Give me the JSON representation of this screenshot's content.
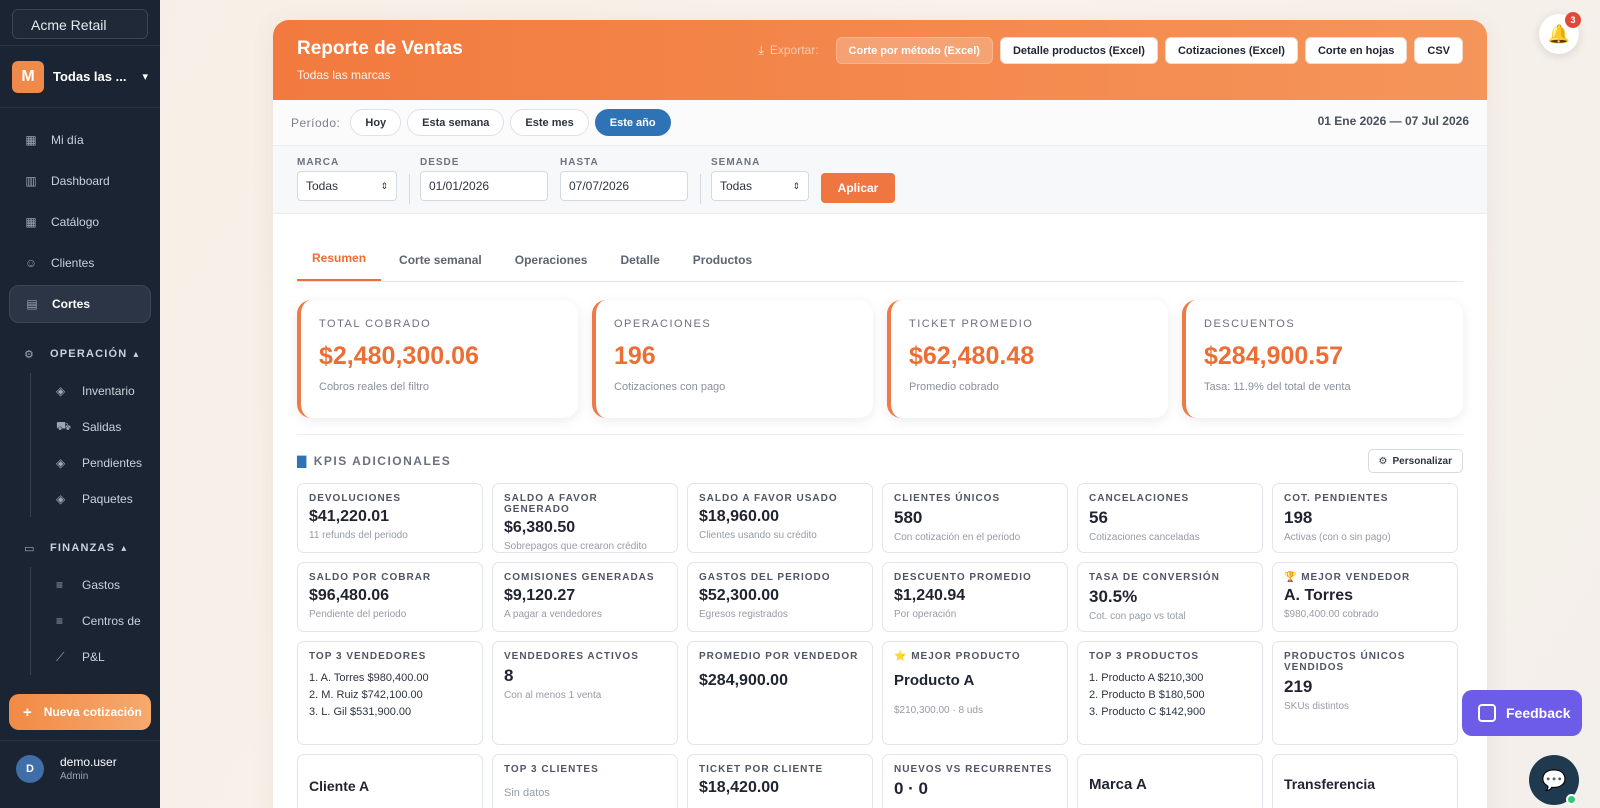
{
  "sidebar": {
    "search_value": "Acme Retail",
    "brand": {
      "initial": "M",
      "name": "Todas las ..."
    },
    "nav": [
      {
        "label": "Mi día",
        "icon": "calendar-icon",
        "active": false
      },
      {
        "label": "Dashboard",
        "icon": "chart-icon",
        "active": false
      },
      {
        "label": "Catálogo",
        "icon": "grid-icon",
        "active": false
      },
      {
        "label": "Clientes",
        "icon": "users-icon",
        "active": false
      },
      {
        "label": "Cortes",
        "icon": "document-icon",
        "active": true
      }
    ],
    "operacion": {
      "label": "OPERACIÓN",
      "items": [
        {
          "label": "Inventario",
          "icon": "box-icon"
        },
        {
          "label": "Salidas",
          "icon": "truck-icon"
        },
        {
          "label": "Pendientes",
          "icon": "box-icon"
        },
        {
          "label": "Paquetes",
          "icon": "box-icon"
        }
      ]
    },
    "finanzas": {
      "label": "FINANZAS",
      "items": [
        {
          "label": "Gastos",
          "icon": "list-icon"
        },
        {
          "label": "Centros de",
          "icon": "list-icon"
        },
        {
          "label": "P&L",
          "icon": "trend-icon"
        }
      ]
    },
    "new_button": "Nueva cotización",
    "user": {
      "initial": "D",
      "name": "demo.user",
      "role": "Admin"
    }
  },
  "header": {
    "title": "Reporte de Ventas",
    "subtitle": "Todas las marcas",
    "export_label": "Exportar:",
    "exports": [
      "Corte por método (Excel)",
      "Detalle productos (Excel)",
      "Cotizaciones (Excel)",
      "Corte en hojas",
      "CSV"
    ]
  },
  "period": {
    "label": "Período:",
    "options": [
      "Hoy",
      "Esta semana",
      "Este mes",
      "Este año"
    ],
    "active": "Este año",
    "range": "01 Ene 2026 — 07 Jul 2026"
  },
  "filters": {
    "marca": {
      "label": "MARCA",
      "value": "Todas"
    },
    "desde": {
      "label": "DESDE",
      "value": "01/01/2026"
    },
    "hasta": {
      "label": "HASTA",
      "value": "07/07/2026"
    },
    "semana": {
      "label": "SEMANA",
      "value": "Todas"
    },
    "apply": "Aplicar"
  },
  "tabs": [
    "Resumen",
    "Corte semanal",
    "Operaciones",
    "Detalle",
    "Productos"
  ],
  "kpis": [
    {
      "label": "TOTAL COBRADO",
      "value": "$2,480,300.06",
      "sub": "Cobros reales del filtro"
    },
    {
      "label": "OPERACIONES",
      "value": "196",
      "sub": "Cotizaciones con pago"
    },
    {
      "label": "TICKET PROMEDIO",
      "value": "$62,480.48",
      "sub": "Promedio cobrado"
    },
    {
      "label": "DESCUENTOS",
      "value": "$284,900.57",
      "sub": "Tasa: 11.9% del total de venta"
    }
  ],
  "additional": {
    "title": "KPIS ADICIONALES",
    "customize": "Personalizar",
    "row1": [
      {
        "label": "DEVOLUCIONES",
        "value": "$41,220.01",
        "sub": "11 refunds del periodo"
      },
      {
        "label": "SALDO A FAVOR GENERADO",
        "value": "$6,380.50",
        "sub": "Sobrepagos que crearon crédito"
      },
      {
        "label": "SALDO A FAVOR USADO",
        "value": "$18,960.00",
        "sub": "Clientes usando su crédito"
      },
      {
        "label": "CLIENTES ÚNICOS",
        "value": "580",
        "sub": "Con cotización en el periodo"
      },
      {
        "label": "CANCELACIONES",
        "value": "56",
        "sub": "Cotizaciones canceladas"
      },
      {
        "label": "COT. PENDIENTES",
        "value": "198",
        "sub": "Activas (con o sin pago)"
      }
    ],
    "row2": [
      {
        "label": "SALDO POR COBRAR",
        "value": "$96,480.06",
        "sub": "Pendiente del periodo"
      },
      {
        "label": "COMISIONES GENERADAS",
        "value": "$9,120.27",
        "sub": "A pagar a vendedores"
      },
      {
        "label": "GASTOS DEL PERIODO",
        "value": "$52,300.00",
        "sub": "Egresos registrados"
      },
      {
        "label": "DESCUENTO PROMEDIO",
        "value": "$1,240.94",
        "sub": "Por operación"
      },
      {
        "label": "TASA DE CONVERSIÓN",
        "value": "30.5%",
        "sub": "Cot. con pago vs total"
      },
      {
        "label": "🏆 MEJOR VENDEDOR",
        "value": "A. Torres",
        "sub": "$980,400.00 cobrado"
      }
    ],
    "top_vendedores": {
      "label": "TOP 3 VENDEDORES",
      "lines": [
        "1. A. Torres   $980,400.00",
        "2. M. Ruiz   $742,100.00",
        "3. L. Gil   $531,900.00"
      ]
    },
    "vendedores_activos": {
      "label": "VENDEDORES ACTIVOS",
      "value": "8",
      "sub": "Con al menos 1 venta"
    },
    "promedio_vendedor": {
      "label": "PROMEDIO POR VENDEDOR",
      "value": "$284,900.00"
    },
    "mejor_producto": {
      "label": "⭐ MEJOR PRODUCTO",
      "value": "Producto A",
      "sub": "$210,300.00 · 8 uds"
    },
    "top_productos": {
      "label": "TOP 3 PRODUCTOS",
      "lines": [
        "1. Producto A   $210,300",
        "2. Producto B   $180,500",
        "3. Producto C   $142,900"
      ]
    },
    "productos_unicos": {
      "label": "PRODUCTOS ÚNICOS VENDIDOS",
      "value": "219",
      "sub": "SKUs distintos"
    },
    "row4": [
      {
        "label": "",
        "value": "Cliente A"
      },
      {
        "label": "TOP 3 CLIENTES",
        "value": "",
        "sub": "Sin datos"
      },
      {
        "label": "TICKET POR CLIENTE",
        "value": "$18,420.00"
      },
      {
        "label": "NUEVOS VS RECURRENTES",
        "value": "0 · 0"
      },
      {
        "label": "",
        "value": "Marca A"
      },
      {
        "label": "",
        "value": "Transferencia"
      }
    ]
  },
  "floating": {
    "notifications": "3",
    "feedback": "Feedback"
  },
  "colors": {
    "accent": "#ef7541",
    "primary_blue": "#2f73b7",
    "sidebar": "#1b2432"
  }
}
